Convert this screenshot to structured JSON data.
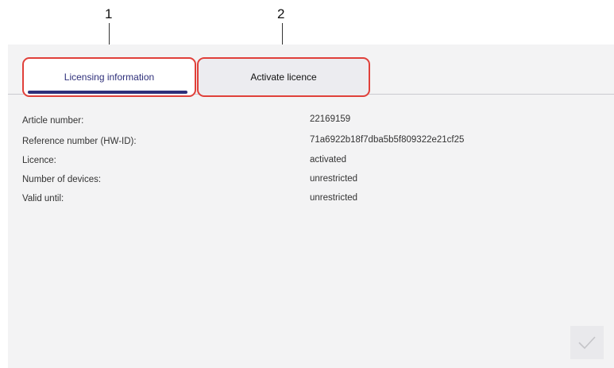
{
  "callouts": [
    "1",
    "2"
  ],
  "tabs": [
    {
      "label": "Licensing information",
      "active": true
    },
    {
      "label": "Activate licence",
      "active": false
    }
  ],
  "info_rows": [
    {
      "label": "Article number:",
      "value": "22169159"
    },
    {
      "label": "Reference number (HW-ID):",
      "value": "71a6922b18f7dba5b5f809322e21cf25"
    },
    {
      "label": "Licence:",
      "value": "activated"
    },
    {
      "label": "Number of devices:",
      "value": "unrestricted"
    },
    {
      "label": "Valid until:",
      "value": "unrestricted"
    }
  ],
  "colors": {
    "accent": "#2e2f7a",
    "highlight": "#e0403a",
    "panel": "#f3f3f4"
  },
  "icons": {
    "confirm": "checkmark-icon"
  }
}
